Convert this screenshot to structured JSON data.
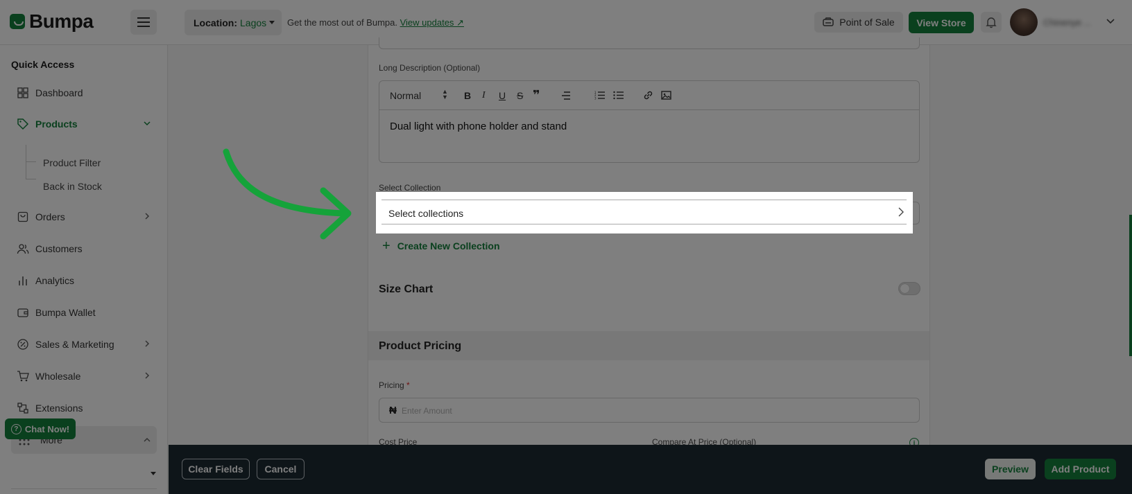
{
  "brand": {
    "name": "Bumpa",
    "accent": "#15803d"
  },
  "header": {
    "location_label": "Location:",
    "location_value": "Lagos",
    "promo_text": "Get the most out of Bumpa.",
    "promo_link": "View updates",
    "pos_label": "Point of Sale",
    "view_store_label": "View Store",
    "user_name": "Chinenye ..."
  },
  "sidebar": {
    "section_title": "Quick Access",
    "items": [
      {
        "label": "Dashboard",
        "icon": "grid-icon"
      },
      {
        "label": "Products",
        "icon": "tag-icon",
        "active": true
      },
      {
        "label": "Orders",
        "icon": "bag-icon"
      },
      {
        "label": "Customers",
        "icon": "users-icon"
      },
      {
        "label": "Analytics",
        "icon": "bar-chart-icon"
      },
      {
        "label": "Bumpa Wallet",
        "icon": "wallet-icon"
      },
      {
        "label": "Sales & Marketing",
        "icon": "percent-icon"
      },
      {
        "label": "Wholesale",
        "icon": "cart-icon"
      },
      {
        "label": "Extensions",
        "icon": "extensions-icon"
      },
      {
        "label": "More",
        "icon": "dots-grid-icon"
      }
    ],
    "product_subitems": [
      "Product Filter",
      "Back in Stock"
    ],
    "chat_label": "Chat Now!"
  },
  "form": {
    "long_description_label": "Long Description (Optional)",
    "editor_format": "Normal",
    "editor_text": "Dual light with phone holder and stand",
    "select_collection_label": "Select Collection",
    "select_collection_placeholder": "Select collections",
    "create_collection_label": "Create New Collection",
    "size_chart_label": "Size Chart",
    "size_chart_enabled": false,
    "pricing_section_title": "Product Pricing",
    "pricing_label": "Pricing",
    "required_marker": "*",
    "currency_symbol": "₦",
    "amount_placeholder": "Enter Amount",
    "cost_price_label": "Cost Price",
    "compare_price_label": "Compare At Price (Optional)"
  },
  "actions": {
    "clear_label": "Clear Fields",
    "cancel_label": "Cancel",
    "preview_label": "Preview",
    "add_label": "Add Product"
  }
}
